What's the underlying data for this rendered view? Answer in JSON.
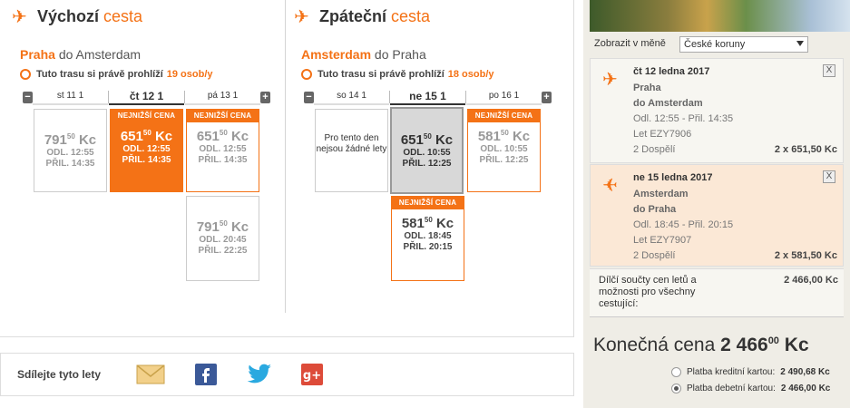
{
  "outbound": {
    "title_bold": "Výchozí",
    "title_light": "cesta",
    "origin": "Praha",
    "route_rest": "do Amsterdam",
    "viewing_text": "Tuto trasu si právě prohlíží",
    "viewing_count": "19 osob/y",
    "days": [
      "st 11 1",
      "čt 12 1",
      "pá 13 1"
    ],
    "cards": [
      {
        "price_main": "791",
        "price_dec": "50",
        "currency": "Kc",
        "dep": "ODL. 12:55",
        "arr": "PŘIL. 14:35"
      },
      {
        "badge": "NEJNIŽŠÍ CENA",
        "price_main": "651",
        "price_dec": "50",
        "currency": "Kc",
        "dep": "ODL. 12:55",
        "arr": "PŘIL. 14:35"
      },
      {
        "badge": "NEJNIŽŠÍ CENA",
        "price_main": "651",
        "price_dec": "50",
        "currency": "Kc",
        "dep": "ODL. 12:55",
        "arr": "PŘIL. 14:35"
      },
      {
        "price_main": "791",
        "price_dec": "50",
        "currency": "Kc",
        "dep": "ODL. 20:45",
        "arr": "PŘIL. 22:25"
      }
    ]
  },
  "inbound": {
    "title_bold": "Zpáteční",
    "title_light": "cesta",
    "origin": "Amsterdam",
    "route_rest": "do Praha",
    "viewing_text": "Tuto trasu si právě prohlíží",
    "viewing_count": "18 osob/y",
    "days": [
      "so 14 1",
      "ne 15 1",
      "po 16 1"
    ],
    "no_flights": "Pro tento den nejsou žádné lety",
    "cards": [
      {
        "price_main": "651",
        "price_dec": "50",
        "currency": "Kc",
        "dep": "ODL. 10:55",
        "arr": "PŘIL. 12:25"
      },
      {
        "badge": "NEJNIŽŠÍ CENA",
        "price_main": "581",
        "price_dec": "50",
        "currency": "Kc",
        "dep": "ODL. 10:55",
        "arr": "PŘIL. 12:25"
      },
      {
        "badge": "NEJNIŽŠÍ CENA",
        "price_main": "581",
        "price_dec": "50",
        "currency": "Kc",
        "dep": "ODL. 18:45",
        "arr": "PŘIL. 20:15"
      }
    ]
  },
  "share": {
    "label": "Sdílejte tyto lety",
    "icons": [
      "email-icon",
      "facebook-icon",
      "twitter-icon",
      "google-plus-icon"
    ]
  },
  "summary": {
    "currency_label": "Zobrazit v měně",
    "currency_value": "České koruny",
    "flight1": {
      "date": "čt 12 ledna 2017",
      "from": "Praha",
      "to": "do Amsterdam",
      "times": "Odl. 12:55 - Přil. 14:35",
      "flight_no": "Let EZY7906",
      "pax": "2 Dospělí",
      "total": "2 x 651,50 Kc",
      "remove": "X"
    },
    "flight2": {
      "date": "ne 15 ledna 2017",
      "from": "Amsterdam",
      "to": "do Praha",
      "times": "Odl. 18:45 - Přil. 20:15",
      "flight_no": "Let EZY7907",
      "pax": "2 Dospělí",
      "total": "2 x 581,50 Kc",
      "remove": "X"
    },
    "subtotal_label": "Dílčí součty cen letů a možnosti pro všechny cestující:",
    "subtotal_value": "2 466,00 Kc",
    "final_label": "Konečná cena",
    "final_main": "2 466",
    "final_dec": "00",
    "final_currency": "Kc",
    "pay_credit_label": "Platba kreditní kartou:",
    "pay_credit_value": "2 490,68 Kc",
    "pay_debit_label": "Platba debetní kartou:",
    "pay_debit_value": "2 466,00 Kc"
  },
  "colors": {
    "accent": "#f47216",
    "panel_bg": "#efede6",
    "selected_card": "#d8d8d8"
  }
}
